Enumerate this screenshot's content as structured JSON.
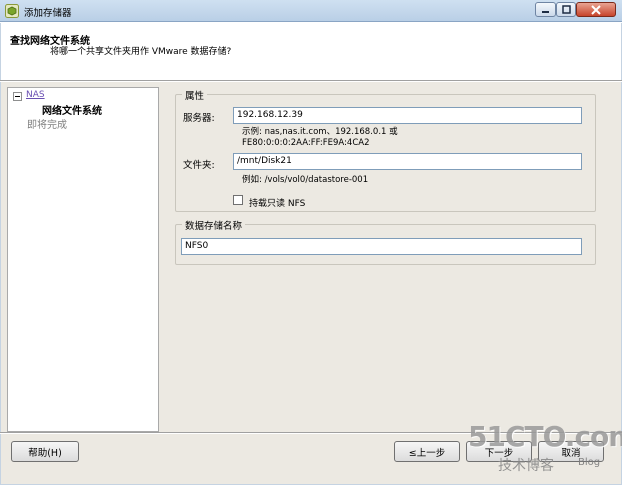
{
  "window": {
    "title": "添加存储器"
  },
  "header": {
    "title": "查找网络文件系统",
    "subtitle": "将哪一个共享文件夹用作 VMware 数据存储?"
  },
  "nav": {
    "items": [
      {
        "label": "NAS"
      },
      {
        "label": "网络文件系统"
      },
      {
        "label": "即将完成"
      }
    ]
  },
  "properties": {
    "legend": "属性",
    "server_label": "服务器:",
    "server_value": "192.168.12.39",
    "server_hint_line1": "示例: nas,nas.it.com、192.168.0.1 或",
    "server_hint_line2": "FE80:0:0:0:2AA:FF:FE9A:4CA2",
    "folder_label": "文件夹:",
    "folder_value": "/mnt/Disk21",
    "folder_hint": "例如: /vols/vol0/datastore-001",
    "readonly_label": "持载只读 NFS",
    "readonly_checked": false
  },
  "datastore": {
    "legend": "数据存储名称",
    "name_value": "NFS0"
  },
  "buttons": {
    "help": "帮助(H)",
    "back": "≤上一步",
    "next": "下一步",
    "cancel": "取消"
  },
  "watermark": {
    "site": "51CTO.com",
    "tagline": "技术博客",
    "blog": "Blog"
  }
}
